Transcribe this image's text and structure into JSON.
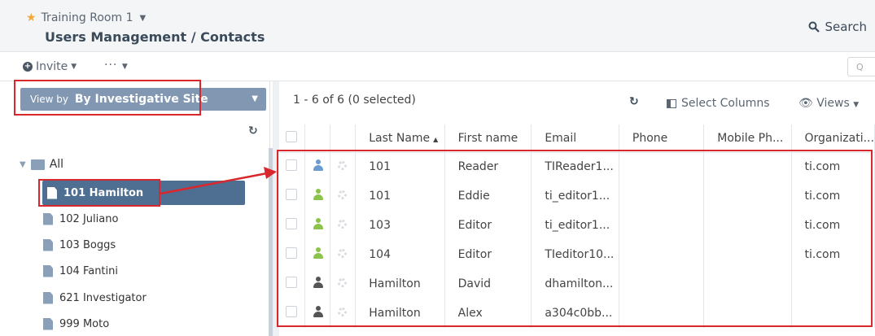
{
  "header": {
    "room": "Training Room 1",
    "title": "Users Management / Contacts",
    "search": "Search"
  },
  "toolbar": {
    "invite": "Invite",
    "more": "···"
  },
  "sidebar": {
    "view_by_prefix": "View by",
    "view_by_value": "By Investigative Site",
    "root": "All",
    "sites": [
      "101 Hamilton",
      "102 Juliano",
      "103 Boggs",
      "104 Fantini",
      "621 Investigator",
      "999 Moto"
    ]
  },
  "grid": {
    "count": "1 - 6 of 6 (0 selected)",
    "select_columns": "Select Columns",
    "views": "Views",
    "columns": [
      "Last Name",
      "First name",
      "Email",
      "Phone",
      "Mobile Ph...",
      "Organizati..."
    ],
    "rows": [
      {
        "last": "101",
        "first": "Reader",
        "email": "TIReader1...",
        "phone": "",
        "mobile": "",
        "org": "ti.com",
        "color": "#6b9bd1"
      },
      {
        "last": "101",
        "first": "Eddie",
        "email": "ti_editor1...",
        "phone": "",
        "mobile": "",
        "org": "ti.com",
        "color": "#8cc34b"
      },
      {
        "last": "103",
        "first": "Editor",
        "email": "ti_editor1...",
        "phone": "",
        "mobile": "",
        "org": "ti.com",
        "color": "#8cc34b"
      },
      {
        "last": "104",
        "first": "Editor",
        "email": "TIeditor10...",
        "phone": "",
        "mobile": "",
        "org": "ti.com",
        "color": "#8cc34b"
      },
      {
        "last": "Hamilton",
        "first": "David",
        "email": "dhamilton...",
        "phone": "",
        "mobile": "",
        "org": "",
        "color": "#555555"
      },
      {
        "last": "Hamilton",
        "first": "Alex",
        "email": "a304c0bb...",
        "phone": "",
        "mobile": "",
        "org": "",
        "color": "#555555"
      }
    ]
  },
  "colors": {
    "annotation": "#d9272e",
    "selected_site": "#4e6f92",
    "view_by_bar": "#8197b2"
  }
}
